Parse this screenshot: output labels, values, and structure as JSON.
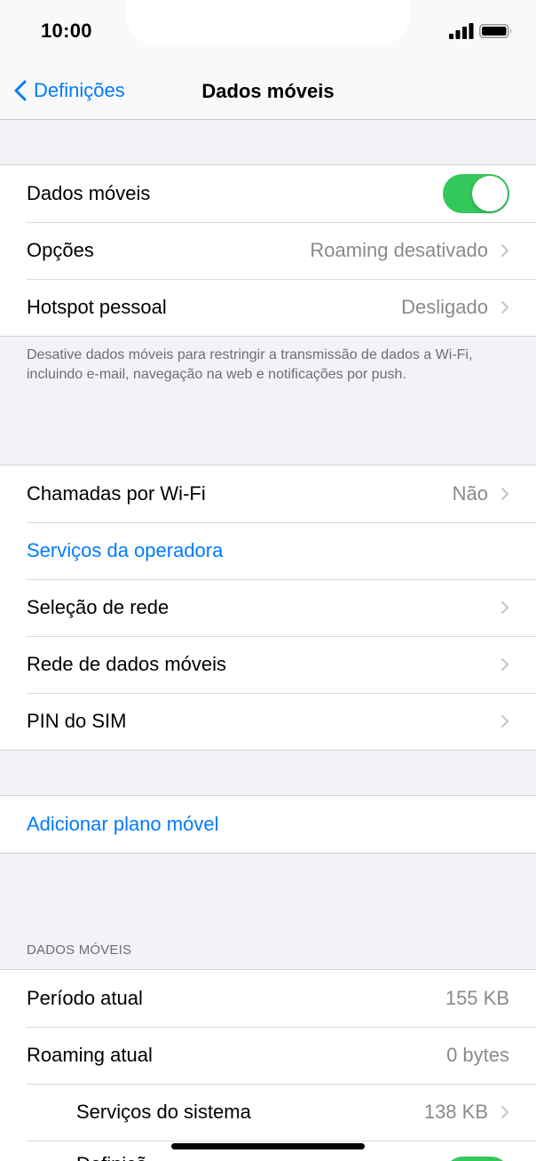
{
  "status_bar": {
    "time": "10:00",
    "signal_icon": "cellular-signal-icon",
    "battery_icon": "battery-icon"
  },
  "nav": {
    "back_label": "Definições",
    "back_icon": "chevron-left-icon",
    "title": "Dados móveis"
  },
  "colors": {
    "accent": "#007aff",
    "toggle_on": "#34c759",
    "secondary_text": "#8a8a8e",
    "background": "#f2f2f7"
  },
  "group1": {
    "mobile_data_label": "Dados móveis",
    "mobile_data_on": true,
    "options_label": "Opções",
    "options_value": "Roaming desativado",
    "hotspot_label": "Hotspot pessoal",
    "hotspot_value": "Desligado",
    "footer": "Desative dados móveis para restringir a transmissão de dados a Wi-Fi, incluindo e-mail, navegação na web e notificações por push."
  },
  "group2": {
    "wifi_calls_label": "Chamadas por Wi-Fi",
    "wifi_calls_value": "Não",
    "carrier_services_label": "Serviços da operadora",
    "network_selection_label": "Seleção de rede",
    "mobile_data_network_label": "Rede de dados móveis",
    "sim_pin_label": "PIN do SIM"
  },
  "group3": {
    "add_plan_label": "Adicionar plano móvel"
  },
  "usage": {
    "header": "DADOS MÓVEIS",
    "current_period_label": "Período atual",
    "current_period_value": "155 KB",
    "current_roaming_label": "Roaming atual",
    "current_roaming_value": "0 bytes",
    "system_services_label": "Serviços do sistema",
    "system_services_value": "138 KB",
    "partial_label": "Definiçõ",
    "partial_toggle_on": true
  }
}
